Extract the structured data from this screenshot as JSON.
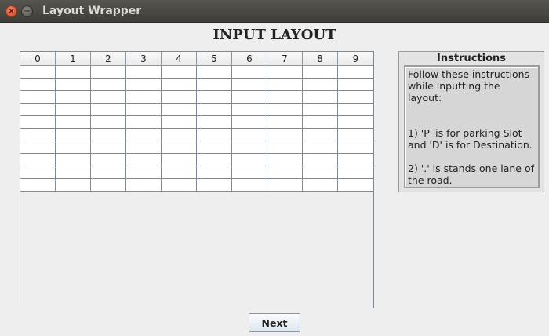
{
  "window": {
    "title": "Layout Wrapper",
    "close_glyph": "×",
    "minimize_glyph": "−"
  },
  "heading": "INPUT LAYOUT",
  "grid": {
    "columns": [
      "0",
      "1",
      "2",
      "3",
      "4",
      "5",
      "6",
      "7",
      "8",
      "9"
    ],
    "row_count": 10
  },
  "instructions": {
    "title": "Instructions",
    "intro": "Follow these instructions while inputting the layout:",
    "rule1": "1) 'P' is for parking Slot and 'D' is for Destination.",
    "rule2": "2) '.' is stands one lane of the road."
  },
  "buttons": {
    "next": "Next"
  }
}
